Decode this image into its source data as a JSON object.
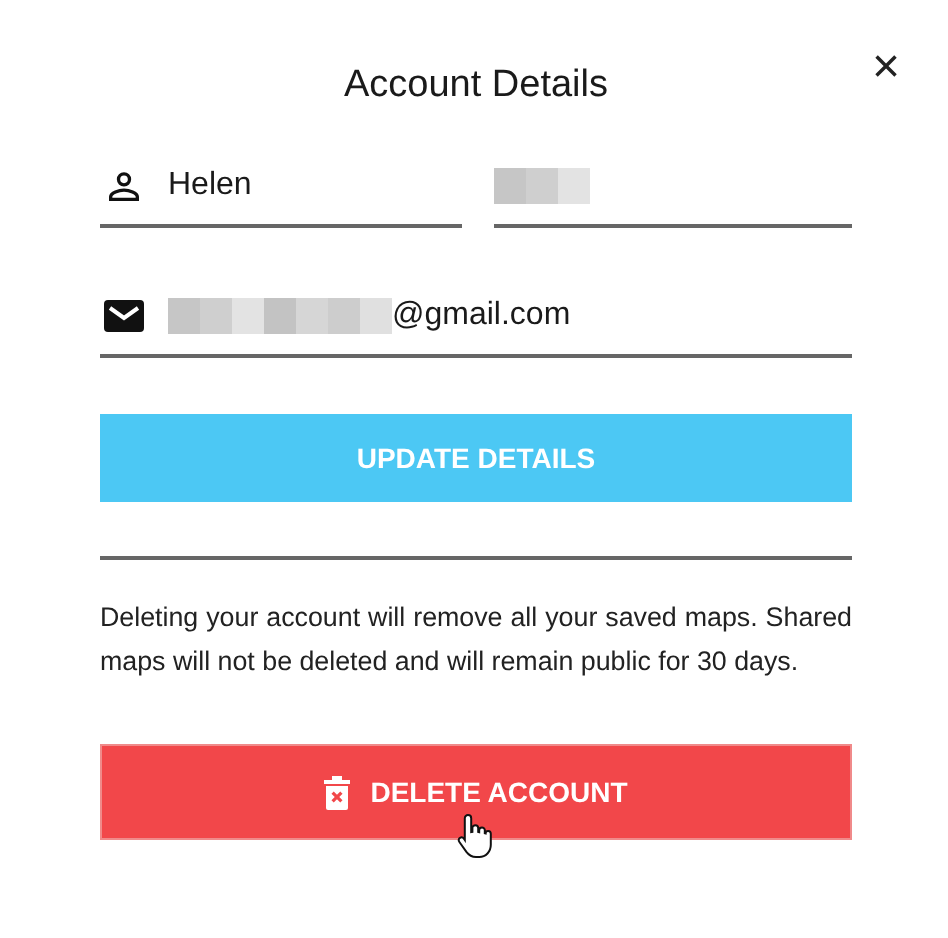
{
  "dialog": {
    "title": "Account Details",
    "close": "×"
  },
  "fields": [
    {
      "kind": "first_name",
      "value": "Helen",
      "redacted": false
    },
    {
      "kind": "last_name",
      "redacted": true
    },
    {
      "kind": "email",
      "value": "@gmail.com",
      "redacted": true
    }
  ],
  "update_button": "UPDATE DETAILS",
  "notice": "Deleting your account will remove all your saved maps. Shared maps will not be deleted and will remain public for 30 days.",
  "delete_button": "DELETE ACCOUNT",
  "pointer_cursor_shown": true
}
